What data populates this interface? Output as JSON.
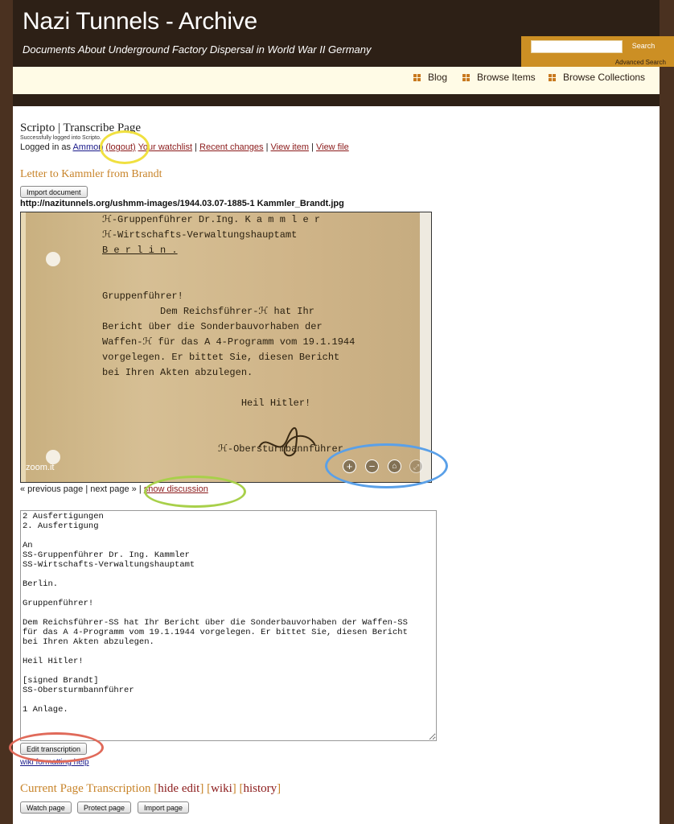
{
  "site": {
    "title": "Nazi Tunnels - Archive",
    "description": "Documents About Underground Factory Dispersal in World War II Germany"
  },
  "search": {
    "placeholder": "",
    "button_label": "Search",
    "advanced_label": "Advanced Search"
  },
  "nav": {
    "items": [
      {
        "label": "Blog"
      },
      {
        "label": "Browse Items"
      },
      {
        "label": "Browse Collections"
      }
    ]
  },
  "page": {
    "heading": "Scripto | Transcribe Page",
    "flash_message": "Successfully logged into Scripto.",
    "logged_in_prefix": "Logged in as",
    "username": "Ammon",
    "logout_label": "(logout)",
    "watchlist_label": "Your watchlist",
    "recent_changes_label": "Recent changes",
    "view_item_label": "View item",
    "view_file_label": "View file",
    "separator": "|",
    "document_title": "Letter to Kammler from Brandt",
    "import_document_label": "Import document",
    "file_url": "http://nazitunnels.org/ushmm-images/1944.03.07-1885-1 Kammler_Brandt.jpg"
  },
  "viewer": {
    "document_lines": [
      "ℋ-Gruppenführer Dr.Ing. K a m m l e r",
      "ℋ-Wirtschafts-Verwaltungshauptamt",
      "B e r l i n .",
      "",
      "",
      "Gruppenführer!",
      "          Dem Reichsführer-ℋ hat Ihr",
      "Bericht über die Sonderbauvorhaben der",
      "Waffen-ℋ für das A 4-Programm vom 19.1.1944",
      "vorgelegen. Er bittet Sie, diesen Bericht",
      "bei Ihren Akten abzulegen.",
      "",
      "                        Heil Hitler!",
      "",
      "",
      "                    ℋ-Obersturmbannführer"
    ],
    "brand_label": "zoom.it",
    "controls": [
      "zoom-in",
      "zoom-out",
      "home",
      "fullscreen"
    ]
  },
  "pager": {
    "previous_label": "« previous page",
    "next_label": "next page »",
    "discussion_label": "show discussion",
    "separator": "|"
  },
  "transcription": {
    "text": "2 Ausfertigungen\n2. Ausfertigung\n\nAn\nSS-Gruppenführer Dr. Ing. Kammler\nSS-Wirtschafts-Verwaltungshauptamt\n\nBerlin.\n\nGruppenführer!\n\nDem Reichsführer-SS hat Ihr Bericht über die Sonderbauvorhaben der Waffen-SS\nfür das A 4-Programm vom 19.1.1944 vorgelegen. Er bittet Sie, diesen Bericht\nbei Ihren Akten abzulegen.\n\nHeil Hitler!\n\n[signed Brandt]\nSS-Obersturmbannführer\n\n1 Anlage.",
    "edit_button_label": "Edit transcription",
    "wiki_help_label": "wiki formatting help"
  },
  "current": {
    "heading": "Current Page Transcription",
    "hide_edit_label": "hide edit",
    "wiki_label": "wiki",
    "history_label": "history",
    "watch_label": "Watch page",
    "protect_label": "Protect page",
    "import_label": "Import page"
  },
  "colors": {
    "header_bg": "#2d2016",
    "accent_gold": "#cc8f24",
    "nav_bg": "#fffbe6",
    "link_red": "#8b1a1a",
    "ring_yellow": "#f0e040",
    "ring_green": "#a8d04a",
    "ring_blue": "#5aa0e8",
    "ring_red": "#e06a5a"
  }
}
